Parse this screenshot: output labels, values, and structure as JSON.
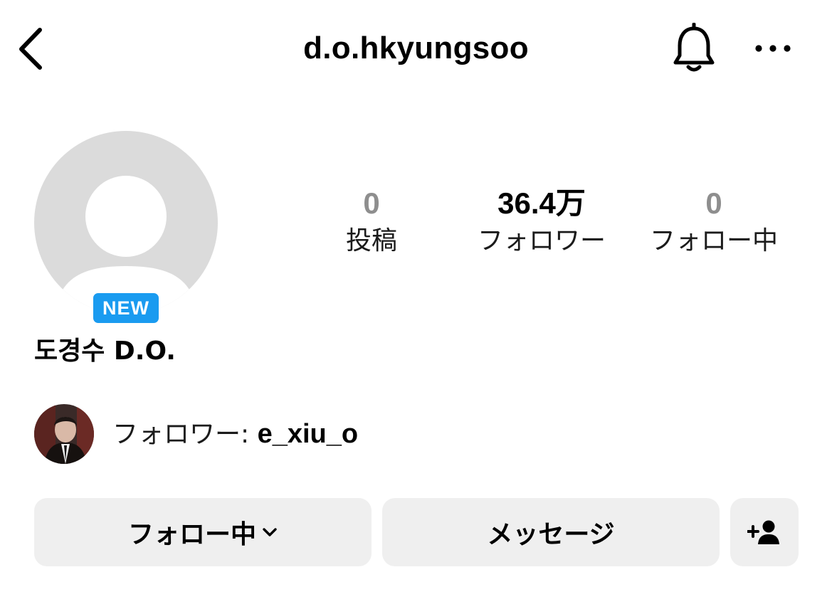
{
  "header": {
    "username": "d.o.hkyungsoo",
    "icons": {
      "back": "chevron-left-icon",
      "notifications": "bell-icon",
      "more": "more-horizontal-icon"
    }
  },
  "profile": {
    "badge": "NEW",
    "display_name": "도경수 D.O.",
    "avatar_icon": "default-avatar-icon"
  },
  "stats": [
    {
      "value": "0",
      "label": "投稿"
    },
    {
      "value": "36.4万",
      "label": "フォロワー"
    },
    {
      "value": "0",
      "label": "フォロー中"
    }
  ],
  "followed_by": {
    "prefix": "フォロワー: ",
    "username": "e_xiu_o"
  },
  "actions": {
    "following_label": "フォロー中",
    "message_label": "メッセージ",
    "add_icon": "add-person-icon"
  },
  "colors": {
    "badge": "#1a9bf0",
    "button_bg": "#efefef",
    "avatar_bg": "#dbdbdb",
    "muted_count": "#8e8e8e"
  }
}
